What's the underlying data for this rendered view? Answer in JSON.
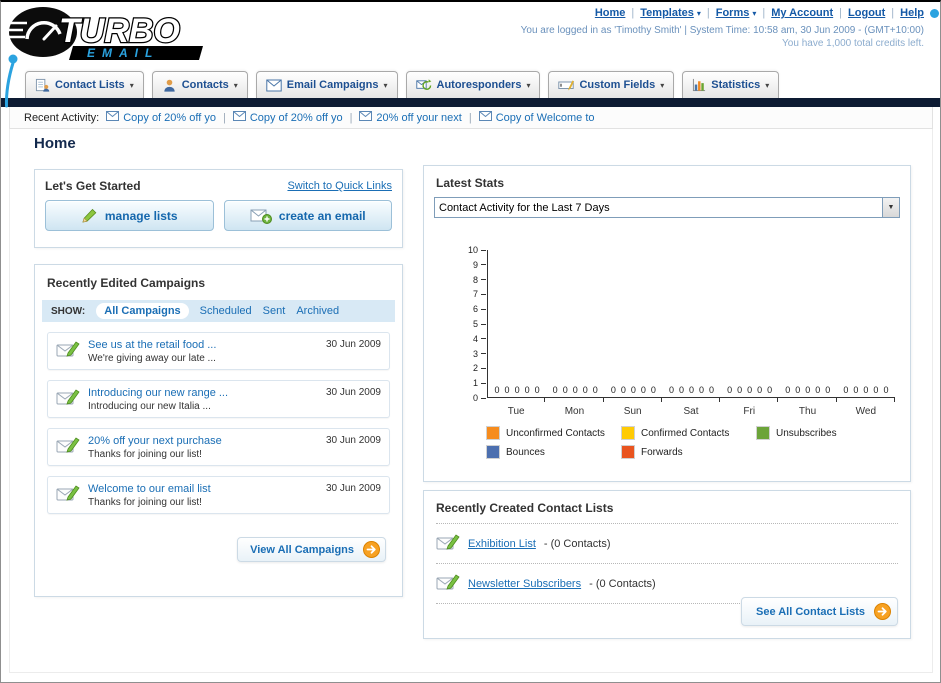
{
  "theme": {
    "link_blue": "#1a6eb5",
    "nav_bar_navy": "#0d1b33",
    "accent_orange": "#f7a122",
    "logo_blue": "#2ba3e0"
  },
  "header": {
    "logo_title": "TURBO",
    "logo_subtitle": "EMAIL",
    "nav_links": [
      {
        "label": "Home",
        "dropdown": false
      },
      {
        "label": "Templates",
        "dropdown": true
      },
      {
        "label": "Forms",
        "dropdown": true
      },
      {
        "label": "My Account",
        "dropdown": false
      },
      {
        "label": "Logout",
        "dropdown": false
      },
      {
        "label": "Help",
        "dropdown": false
      }
    ],
    "login_info": "You are logged in as 'Timothy Smith' | System Time: 10:58 am, 30 Jun 2009 - (GMT+10:00)",
    "credits_info": "You have 1,000 total credits left."
  },
  "nav_tabs": [
    {
      "label": "Contact Lists",
      "icon": "contact-lists"
    },
    {
      "label": "Contacts",
      "icon": "contacts"
    },
    {
      "label": "Email Campaigns",
      "icon": "email-campaigns"
    },
    {
      "label": "Autoresponders",
      "icon": "autoresponders"
    },
    {
      "label": "Custom Fields",
      "icon": "custom-fields"
    },
    {
      "label": "Statistics",
      "icon": "statistics"
    }
  ],
  "recent_activity": {
    "label": "Recent Activity:",
    "items": [
      "Copy of 20% off yo",
      "Copy of 20% off yo",
      "20% off your next",
      "Copy of Welcome to"
    ]
  },
  "page_title": "Home",
  "get_started": {
    "title": "Let's Get Started",
    "switch_link": "Switch to Quick Links",
    "buttons": [
      {
        "label": "manage lists",
        "icon": "pencil"
      },
      {
        "label": "create an email",
        "icon": "envelope-plus"
      }
    ]
  },
  "campaigns": {
    "title": "Recently Edited Campaigns",
    "show_label": "SHOW:",
    "filters": [
      "All Campaigns",
      "Scheduled",
      "Sent",
      "Archived"
    ],
    "selected_filter": 0,
    "items": [
      {
        "title": "See us at the retail food ...",
        "subtitle": "We're giving away our late ...",
        "date": "30 Jun 2009"
      },
      {
        "title": "Introducing our new range ...",
        "subtitle": "Introducing our new Italia ...",
        "date": "30 Jun 2009"
      },
      {
        "title": "20% off your next purchase",
        "subtitle": "Thanks for joining our list!",
        "date": "30 Jun 2009"
      },
      {
        "title": "Welcome to our email list",
        "subtitle": "Thanks for joining our list!",
        "date": "30 Jun 2009"
      }
    ],
    "view_all_label": "View All Campaigns"
  },
  "latest_stats": {
    "title": "Latest Stats",
    "dropdown_value": "Contact Activity for the Last 7 Days",
    "chart_data": {
      "type": "bar",
      "title": "Contact Activity for the Last 7 Days",
      "categories": [
        "Tue",
        "Mon",
        "Sun",
        "Sat",
        "Fri",
        "Thu",
        "Wed"
      ],
      "series": [
        {
          "name": "Unconfirmed Contacts",
          "color": "#f68c1e",
          "values": [
            0,
            0,
            0,
            0,
            0,
            0,
            0
          ]
        },
        {
          "name": "Confirmed Contacts",
          "color": "#ffcb05",
          "values": [
            0,
            0,
            0,
            0,
            0,
            0,
            0
          ]
        },
        {
          "name": "Unsubscribes",
          "color": "#6ca439",
          "values": [
            0,
            0,
            0,
            0,
            0,
            0,
            0
          ]
        },
        {
          "name": "Bounces",
          "color": "#4c6faf",
          "values": [
            0,
            0,
            0,
            0,
            0,
            0,
            0
          ]
        },
        {
          "name": "Forwards",
          "color": "#e9541f",
          "values": [
            0,
            0,
            0,
            0,
            0,
            0,
            0
          ]
        }
      ],
      "xlabel": "",
      "ylabel": "",
      "ylim": [
        0,
        10
      ],
      "grid": false,
      "legend_position": "bottom"
    }
  },
  "contact_lists": {
    "title": "Recently Created Contact Lists",
    "items": [
      {
        "name": "Exhibition List",
        "detail": "- (0 Contacts)"
      },
      {
        "name": "Newsletter Subscribers",
        "detail": "- (0 Contacts)"
      }
    ],
    "see_all_label": "See All Contact Lists"
  }
}
